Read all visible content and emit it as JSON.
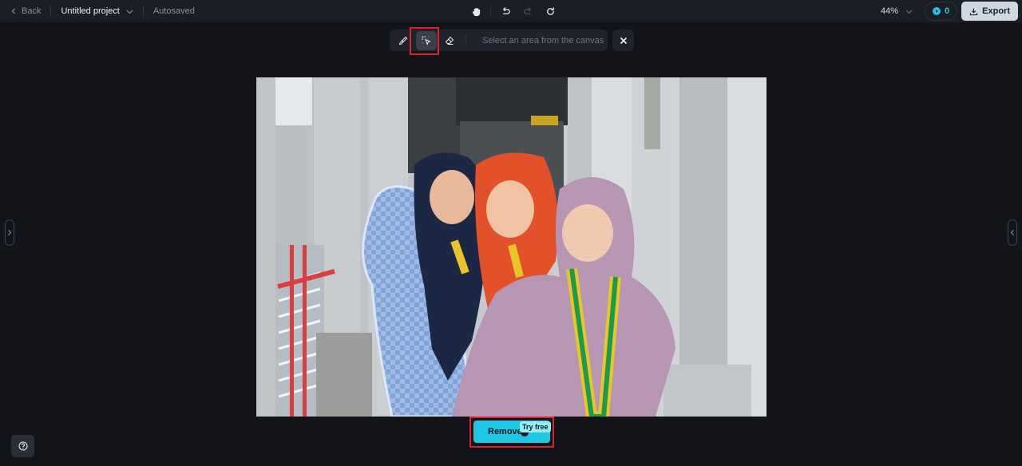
{
  "topbar": {
    "back_label": "Back",
    "project_title": "Untitled project",
    "save_status": "Autosaved",
    "zoom_level": "44%",
    "credits_count": "0",
    "export_label": "Export"
  },
  "toolbar": {
    "tools": [
      {
        "name": "brush",
        "icon": "brush-icon",
        "active": false
      },
      {
        "name": "auto-select",
        "icon": "select-cursor-icon",
        "active": true
      },
      {
        "name": "eraser",
        "icon": "eraser-icon",
        "active": false
      }
    ],
    "hint": "Select an area from the canvas"
  },
  "action": {
    "remove_label": "Remove",
    "badge_label": "Try free"
  },
  "colors": {
    "accent": "#1ec8e4",
    "highlight": "#e0202a",
    "background": "#121419",
    "topbar": "#1b1e25"
  }
}
